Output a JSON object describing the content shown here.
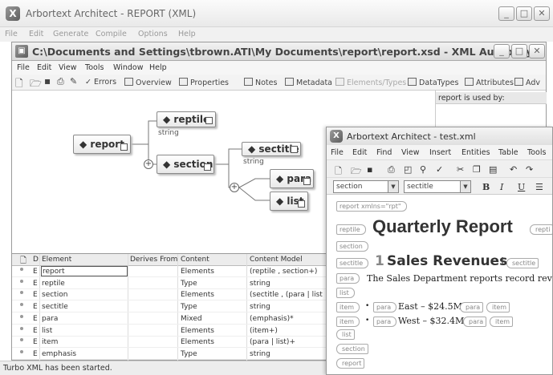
{
  "outer": {
    "title": "Arbortext Architect - REPORT (XML)",
    "menu": [
      "File",
      "Edit",
      "Generate",
      "Compile",
      "Options",
      "Help"
    ]
  },
  "inner": {
    "title": "C:\\Documents and Settings\\tbrown.ATI\\My Documents\\report\\report.xsd - XML Authority",
    "menu": [
      "File",
      "Edit",
      "View",
      "Tools",
      "Window",
      "Help"
    ],
    "toolbar": {
      "errors": "Errors",
      "overview": "Overview",
      "properties": "Properties",
      "notes": "Notes",
      "metadata": "Metadata",
      "elements_types": "Elements/Types",
      "datatypes": "DataTypes",
      "attributes": "Attributes",
      "adv": "Adv"
    },
    "used_by_header": "report is used by:"
  },
  "diagram": {
    "report": "report",
    "reptile": "reptile",
    "reptile_type": "string",
    "section": "section",
    "sectitle": "sectitle",
    "sectitle_type": "string",
    "para": "para",
    "list": "list"
  },
  "table": {
    "headers": [
      "D",
      "Element",
      "Derives From",
      "Content",
      "Content Model"
    ],
    "rows": [
      {
        "d": "E",
        "element": "report",
        "derives": "",
        "content": "Elements",
        "model": "(reptile , section+)"
      },
      {
        "d": "E",
        "element": "reptile",
        "derives": "",
        "content": "Type",
        "model": "string"
      },
      {
        "d": "E",
        "element": "section",
        "derives": "",
        "content": "Elements",
        "model": "(sectitle , (para | list"
      },
      {
        "d": "E",
        "element": "sectitle",
        "derives": "",
        "content": "Type",
        "model": "string"
      },
      {
        "d": "E",
        "element": "para",
        "derives": "",
        "content": "Mixed",
        "model": "(emphasis)*"
      },
      {
        "d": "E",
        "element": "list",
        "derives": "",
        "content": "Elements",
        "model": "(item+)"
      },
      {
        "d": "E",
        "element": "item",
        "derives": "",
        "content": "Elements",
        "model": "(para | list)+"
      },
      {
        "d": "E",
        "element": "emphasis",
        "derives": "",
        "content": "Type",
        "model": "string"
      }
    ]
  },
  "status": "Turbo XML has been started.",
  "doc": {
    "title": "Arbortext Architect - test.xml",
    "menu": [
      "File",
      "Edit",
      "Find",
      "View",
      "Insert",
      "Entities",
      "Table",
      "Tools"
    ],
    "element_combo": "section",
    "tag_combo": "sectitle",
    "bold_label": "B",
    "italic_label": "I",
    "underline_label": "U",
    "report_tag": "report xmlns=\"rpt\"",
    "reptile_tag": "reptile",
    "reptile_close_tag": "repti",
    "heading": "Quarterly Report",
    "section_tag": "section",
    "sectitle_tag": "sectitle",
    "sectitle_num": "1",
    "sectitle_text": "Sales Revenues",
    "sectitle_close": "sectitle",
    "para_tag": "para",
    "para_text": "The Sales Department reports record revenues fo",
    "list_tag": "list",
    "item_tag": "item",
    "item1_text": "East – $24.5M",
    "item2_text": "West – $32.4M",
    "para_close": "para",
    "item_close": "item",
    "list_close": "list",
    "section_close": "section",
    "report_close": "report"
  }
}
